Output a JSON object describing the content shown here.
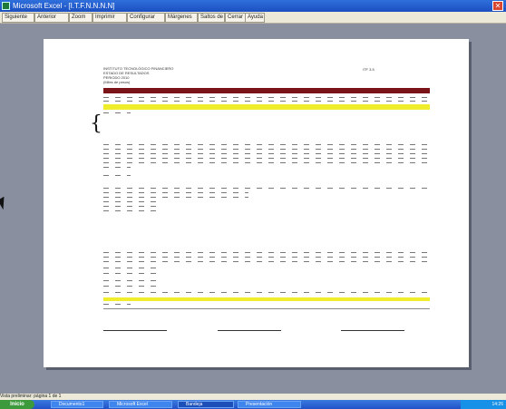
{
  "window": {
    "title": "Microsoft Excel - [I.T.F.N.N.N.N]"
  },
  "toolbar": {
    "buttons": [
      "Siguiente",
      "Anterior",
      "Zoom",
      "Imprimir",
      "Configurar",
      "Márgenes",
      "Saltos de página",
      "Cerrar",
      "Ayuda"
    ]
  },
  "document": {
    "header_right": "ITF 3.5",
    "header_lines": [
      "INSTITUTO TECNOLÓGICO FINANCIERO",
      "ESTADO DE RESULTADOS",
      "PERIODO 2010",
      "(Miles de pesos)"
    ]
  },
  "status": {
    "text": "Vista preliminar: página 1 de 1"
  },
  "taskbar": {
    "start_label": "Inicio",
    "tasks": [
      "Documento1",
      "Microsoft Excel",
      "Bandeja",
      "Presentación"
    ],
    "clock": "14:26"
  }
}
